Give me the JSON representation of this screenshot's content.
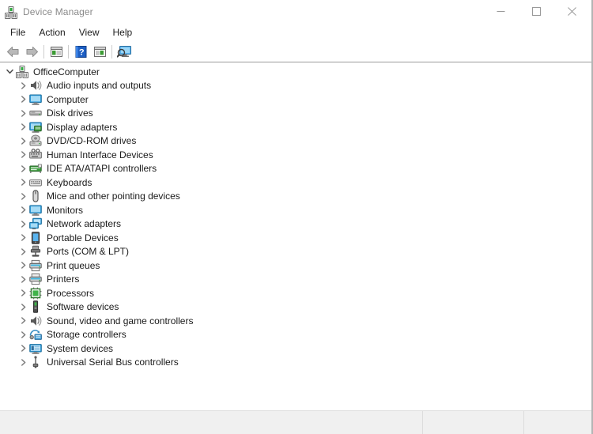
{
  "window": {
    "title": "Device Manager",
    "title_icon": "device-manager-icon",
    "controls": [
      {
        "name": "minimize",
        "glyph": "minimize-icon"
      },
      {
        "name": "maximize",
        "glyph": "maximize-icon"
      },
      {
        "name": "close",
        "glyph": "close-icon"
      }
    ]
  },
  "menubar": {
    "items": [
      {
        "label": "File"
      },
      {
        "label": "Action"
      },
      {
        "label": "View"
      },
      {
        "label": "Help"
      }
    ]
  },
  "toolbar": {
    "buttons": [
      {
        "name": "back-button",
        "icon": "back-arrow-icon"
      },
      {
        "name": "forward-button",
        "icon": "forward-arrow-icon"
      },
      {
        "name": "separator-1",
        "icon": "separator"
      },
      {
        "name": "properties-button",
        "icon": "properties-window-icon"
      },
      {
        "name": "separator-2",
        "icon": "separator"
      },
      {
        "name": "help-button",
        "icon": "help-question-icon"
      },
      {
        "name": "show-hide-console-tree-button",
        "icon": "console-tree-icon"
      },
      {
        "name": "separator-3",
        "icon": "separator"
      },
      {
        "name": "scan-for-hardware-changes-button",
        "icon": "scan-monitor-icon"
      }
    ]
  },
  "tree": {
    "root": {
      "label": "OfficeComputer",
      "icon": "computer-server-icon",
      "expanded": true
    },
    "nodes": [
      {
        "label": "Audio inputs and outputs",
        "icon": "speaker-icon",
        "expanded": false
      },
      {
        "label": "Computer",
        "icon": "monitor-icon",
        "expanded": false
      },
      {
        "label": "Disk drives",
        "icon": "disk-drive-icon",
        "expanded": false
      },
      {
        "label": "Display adapters",
        "icon": "display-adapter-icon",
        "expanded": false
      },
      {
        "label": "DVD/CD-ROM drives",
        "icon": "optical-drive-icon",
        "expanded": false
      },
      {
        "label": "Human Interface Devices",
        "icon": "hid-icon",
        "expanded": false
      },
      {
        "label": "IDE ATA/ATAPI controllers",
        "icon": "ide-controller-icon",
        "expanded": false
      },
      {
        "label": "Keyboards",
        "icon": "keyboard-icon",
        "expanded": false
      },
      {
        "label": "Mice and other pointing devices",
        "icon": "mouse-icon",
        "expanded": false
      },
      {
        "label": "Monitors",
        "icon": "monitor-icon",
        "expanded": false
      },
      {
        "label": "Network adapters",
        "icon": "network-adapter-icon",
        "expanded": false
      },
      {
        "label": "Portable Devices",
        "icon": "portable-device-icon",
        "expanded": false
      },
      {
        "label": "Ports (COM & LPT)",
        "icon": "port-icon",
        "expanded": false
      },
      {
        "label": "Print queues",
        "icon": "printer-icon",
        "expanded": false
      },
      {
        "label": "Printers",
        "icon": "printer-icon",
        "expanded": false
      },
      {
        "label": "Processors",
        "icon": "processor-icon",
        "expanded": false
      },
      {
        "label": "Software devices",
        "icon": "software-device-icon",
        "expanded": false
      },
      {
        "label": "Sound, video and game controllers",
        "icon": "speaker-icon",
        "expanded": false
      },
      {
        "label": "Storage controllers",
        "icon": "storage-controller-icon",
        "expanded": false
      },
      {
        "label": "System devices",
        "icon": "system-device-icon",
        "expanded": false
      },
      {
        "label": "Universal Serial Bus controllers",
        "icon": "usb-icon",
        "expanded": false
      }
    ]
  },
  "statusbar": {
    "panes": [
      {
        "text": ""
      },
      {
        "text": ""
      },
      {
        "text": ""
      }
    ]
  },
  "colors": {
    "title_text": "#8a8a8a",
    "menu_text": "#202020",
    "tree_text": "#1a1a1a",
    "accent_blue": "#1e6fd9",
    "statusbar_bg": "#f0f0f0",
    "content_border": "#9b9b9b"
  }
}
